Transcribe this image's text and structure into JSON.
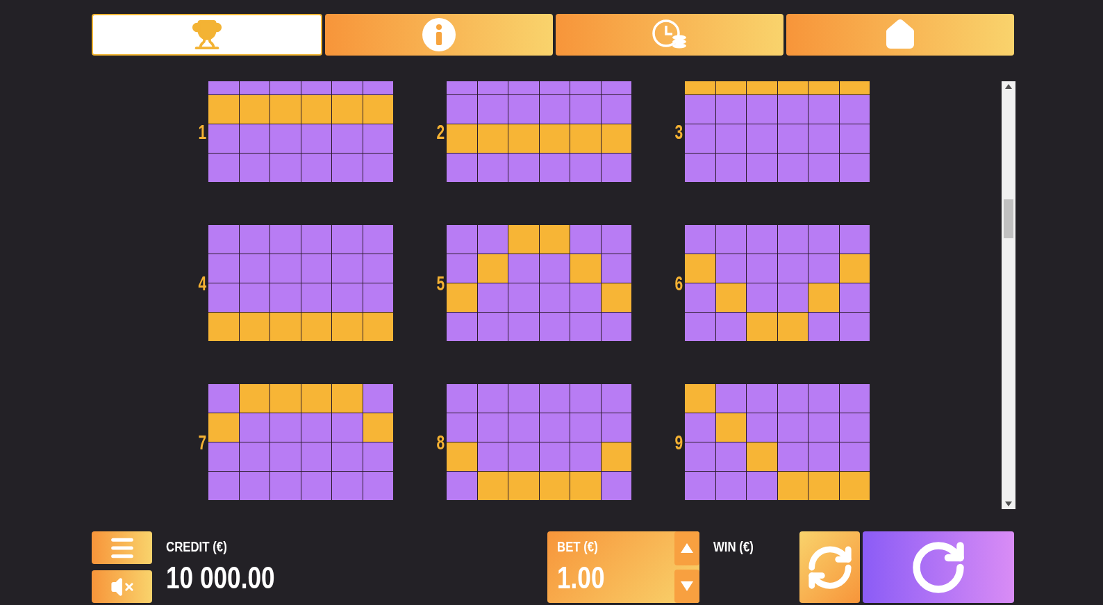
{
  "tabs": [
    {
      "kind": "trophy",
      "selected": true
    },
    {
      "kind": "info",
      "selected": false
    },
    {
      "kind": "history",
      "selected": false
    },
    {
      "kind": "home",
      "selected": false
    }
  ],
  "paylines": [
    {
      "number": "1",
      "cut_top": true,
      "cells": [
        [
          false,
          false,
          false,
          false,
          false,
          false
        ],
        [
          true,
          true,
          true,
          true,
          true,
          true
        ],
        [
          false,
          false,
          false,
          false,
          false,
          false
        ],
        [
          false,
          false,
          false,
          false,
          false,
          false
        ]
      ]
    },
    {
      "number": "2",
      "cut_top": true,
      "cells": [
        [
          false,
          false,
          false,
          false,
          false,
          false
        ],
        [
          false,
          false,
          false,
          false,
          false,
          false
        ],
        [
          true,
          true,
          true,
          true,
          true,
          true
        ],
        [
          false,
          false,
          false,
          false,
          false,
          false
        ]
      ]
    },
    {
      "number": "3",
      "cut_top": true,
      "cells": [
        [
          true,
          true,
          true,
          true,
          true,
          true
        ],
        [
          false,
          false,
          false,
          false,
          false,
          false
        ],
        [
          false,
          false,
          false,
          false,
          false,
          false
        ],
        [
          false,
          false,
          false,
          false,
          false,
          false
        ]
      ]
    },
    {
      "number": "4",
      "cut_top": false,
      "cells": [
        [
          false,
          false,
          false,
          false,
          false,
          false
        ],
        [
          false,
          false,
          false,
          false,
          false,
          false
        ],
        [
          false,
          false,
          false,
          false,
          false,
          false
        ],
        [
          true,
          true,
          true,
          true,
          true,
          true
        ]
      ]
    },
    {
      "number": "5",
      "cut_top": false,
      "cells": [
        [
          false,
          false,
          true,
          true,
          false,
          false
        ],
        [
          false,
          true,
          false,
          false,
          true,
          false
        ],
        [
          true,
          false,
          false,
          false,
          false,
          true
        ],
        [
          false,
          false,
          false,
          false,
          false,
          false
        ]
      ]
    },
    {
      "number": "6",
      "cut_top": false,
      "cells": [
        [
          false,
          false,
          false,
          false,
          false,
          false
        ],
        [
          true,
          false,
          false,
          false,
          false,
          true
        ],
        [
          false,
          true,
          false,
          false,
          true,
          false
        ],
        [
          false,
          false,
          true,
          true,
          false,
          false
        ]
      ]
    },
    {
      "number": "7",
      "cut_top": false,
      "cells": [
        [
          false,
          true,
          true,
          true,
          true,
          false
        ],
        [
          true,
          false,
          false,
          false,
          false,
          true
        ],
        [
          false,
          false,
          false,
          false,
          false,
          false
        ],
        [
          false,
          false,
          false,
          false,
          false,
          false
        ]
      ]
    },
    {
      "number": "8",
      "cut_top": false,
      "cells": [
        [
          false,
          false,
          false,
          false,
          false,
          false
        ],
        [
          false,
          false,
          false,
          false,
          false,
          false
        ],
        [
          true,
          false,
          false,
          false,
          false,
          true
        ],
        [
          false,
          true,
          true,
          true,
          true,
          false
        ]
      ]
    },
    {
      "number": "9",
      "cut_top": false,
      "cells": [
        [
          true,
          false,
          false,
          false,
          false,
          false
        ],
        [
          false,
          true,
          false,
          false,
          false,
          false
        ],
        [
          false,
          false,
          true,
          false,
          false,
          false
        ],
        [
          false,
          false,
          false,
          true,
          true,
          true
        ]
      ]
    }
  ],
  "credit": {
    "label": "CREDIT (€)",
    "value": "10 000.00"
  },
  "bet": {
    "label": "BET (€)",
    "value": "1.00"
  },
  "win": {
    "label": "WIN (€)"
  }
}
